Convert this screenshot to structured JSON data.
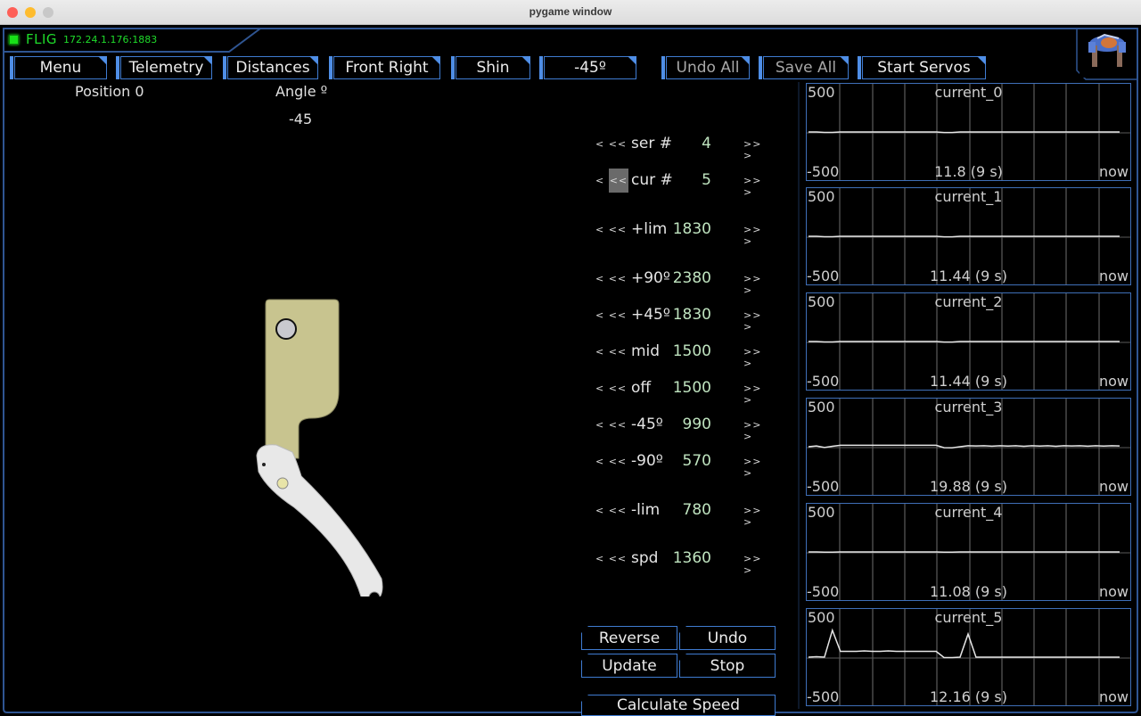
{
  "window": {
    "title": "pygame window"
  },
  "status": {
    "name": "FLIG",
    "address": "172.24.1.176:1883",
    "connected_color": "#18e018"
  },
  "tabs": [
    {
      "label": "Menu",
      "enabled": true
    },
    {
      "label": "Telemetry",
      "enabled": true
    },
    {
      "label": "Distances",
      "enabled": true
    },
    {
      "label": "Front Right",
      "enabled": true
    },
    {
      "label": "Shin",
      "enabled": true
    },
    {
      "label": "-45º",
      "enabled": true
    },
    {
      "label": "Undo All",
      "enabled": false
    },
    {
      "label": "Save All",
      "enabled": false
    },
    {
      "label": "Start Servos",
      "enabled": true
    }
  ],
  "position": {
    "label": "Position 0",
    "angle_label": "Angle º",
    "angle_value": "-45"
  },
  "params": [
    {
      "name": "ser #",
      "value": "4"
    },
    {
      "name": "cur #",
      "value": "5"
    },
    {
      "name": "+lim",
      "value": "1830"
    },
    {
      "name": "+90º",
      "value": "2380"
    },
    {
      "name": "+45º",
      "value": "1830"
    },
    {
      "name": "mid",
      "value": "1500"
    },
    {
      "name": "off",
      "value": "1500"
    },
    {
      "name": "-45º",
      "value": "990"
    },
    {
      "name": "-90º",
      "value": "570"
    },
    {
      "name": "-lim",
      "value": "780"
    },
    {
      "name": "spd",
      "value": "1360"
    }
  ],
  "arrows": {
    "left": "< <<",
    "right": ">> >"
  },
  "actions": {
    "reverse": "Reverse",
    "undo": "Undo",
    "update": "Update",
    "stop": "Stop",
    "calculate_speed": "Calculate Speed"
  },
  "charts": [
    {
      "title": "current_0",
      "ymax": "500",
      "ymin": "-500",
      "stat": "11.8 (9 s)",
      "now": "now"
    },
    {
      "title": "current_1",
      "ymax": "500",
      "ymin": "-500",
      "stat": "11.44 (9 s)",
      "now": "now"
    },
    {
      "title": "current_2",
      "ymax": "500",
      "ymin": "-500",
      "stat": "11.44 (9 s)",
      "now": "now"
    },
    {
      "title": "current_3",
      "ymax": "500",
      "ymin": "-500",
      "stat": "19.88 (9 s)",
      "now": "now"
    },
    {
      "title": "current_4",
      "ymax": "500",
      "ymin": "-500",
      "stat": "11.08 (9 s)",
      "now": "now"
    },
    {
      "title": "current_5",
      "ymax": "500",
      "ymin": "-500",
      "stat": "12.16 (9 s)",
      "now": "now"
    }
  ],
  "chart_data": [
    {
      "type": "line",
      "title": "current_0",
      "ylim": [
        -500,
        500
      ],
      "xlabel": "9 s window",
      "x_end_label": "now",
      "mean": 11.8,
      "series": [
        {
          "name": "current_0",
          "values": [
            0,
            0,
            -5,
            -5,
            0,
            0,
            0,
            0,
            0,
            0,
            0,
            0,
            0,
            0,
            0,
            0,
            0,
            -6,
            -6,
            0,
            0,
            0,
            0,
            0,
            0,
            0,
            0,
            0,
            0,
            0,
            0,
            0,
            0,
            0,
            0,
            0,
            0,
            0,
            0,
            0
          ]
        }
      ]
    },
    {
      "title": "current_1",
      "type": "line",
      "ylim": [
        -500,
        500
      ],
      "x_end_label": "now",
      "mean": 11.44,
      "series": [
        {
          "name": "current_1",
          "values": [
            0,
            0,
            -5,
            -5,
            0,
            0,
            0,
            0,
            0,
            0,
            0,
            0,
            0,
            0,
            0,
            0,
            0,
            -6,
            -6,
            0,
            0,
            0,
            0,
            0,
            0,
            0,
            0,
            0,
            0,
            0,
            0,
            0,
            0,
            0,
            0,
            0,
            0,
            0,
            0,
            0
          ]
        }
      ]
    },
    {
      "title": "current_2",
      "type": "line",
      "ylim": [
        -500,
        500
      ],
      "x_end_label": "now",
      "mean": 11.44,
      "series": [
        {
          "name": "current_2",
          "values": [
            0,
            0,
            -5,
            -5,
            0,
            0,
            0,
            0,
            0,
            0,
            0,
            0,
            0,
            0,
            0,
            0,
            0,
            -6,
            -6,
            0,
            0,
            0,
            0,
            0,
            0,
            0,
            0,
            0,
            0,
            0,
            0,
            0,
            0,
            0,
            0,
            0,
            0,
            0,
            0,
            0
          ]
        }
      ]
    },
    {
      "title": "current_3",
      "type": "line",
      "ylim": [
        -500,
        500
      ],
      "x_end_label": "now",
      "mean": 19.88,
      "series": [
        {
          "name": "current_3",
          "values": [
            0,
            8,
            -8,
            5,
            15,
            15,
            15,
            15,
            15,
            15,
            15,
            15,
            15,
            15,
            15,
            15,
            15,
            -10,
            -12,
            0,
            10,
            8,
            10,
            6,
            10,
            7,
            10,
            5,
            10,
            7,
            10,
            5,
            10,
            8,
            10,
            6,
            10,
            7,
            10,
            8
          ]
        }
      ]
    },
    {
      "title": "current_4",
      "type": "line",
      "ylim": [
        -500,
        500
      ],
      "x_end_label": "now",
      "mean": 11.08,
      "series": [
        {
          "name": "current_4",
          "values": [
            0,
            0,
            -3,
            -3,
            0,
            0,
            0,
            0,
            0,
            0,
            0,
            0,
            0,
            0,
            0,
            0,
            0,
            -3,
            -3,
            0,
            0,
            0,
            0,
            0,
            0,
            0,
            0,
            0,
            0,
            0,
            0,
            0,
            0,
            0,
            0,
            0,
            0,
            0,
            0,
            0
          ]
        }
      ]
    },
    {
      "title": "current_5",
      "type": "line",
      "ylim": [
        -500,
        500
      ],
      "x_end_label": "now",
      "mean": 12.16,
      "series": [
        {
          "name": "current_5",
          "values": [
            0,
            5,
            0,
            280,
            60,
            60,
            60,
            65,
            60,
            60,
            65,
            60,
            60,
            60,
            60,
            60,
            60,
            -5,
            -5,
            0,
            240,
            0,
            0,
            0,
            0,
            0,
            0,
            0,
            0,
            0,
            0,
            0,
            0,
            0,
            0,
            0,
            0,
            0,
            0,
            0
          ]
        }
      ]
    }
  ]
}
